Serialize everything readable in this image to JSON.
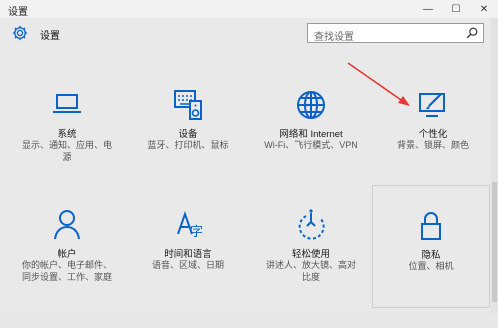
{
  "window": {
    "title": "设置",
    "controls": {
      "minimize": "—",
      "maximize": "☐",
      "close": "✕"
    }
  },
  "header": {
    "icon": "gear-icon",
    "title": "设置"
  },
  "search": {
    "placeholder": "查找设置",
    "icon": "search-icon"
  },
  "accent_color": "#0a63c9",
  "annotation_arrow_color": "#e53935",
  "tiles": [
    {
      "id": "system",
      "icon": "laptop-icon",
      "name": "系统",
      "desc_lines": [
        "显示、通知、应用、电",
        "源"
      ]
    },
    {
      "id": "devices",
      "icon": "keyboard-speaker-icon",
      "name": "设备",
      "desc_lines": [
        "蓝牙、打印机、鼠标"
      ]
    },
    {
      "id": "network",
      "icon": "globe-icon",
      "name": "网络和 Internet",
      "desc_lines": [
        "Wi-Fi、飞行模式、VPN"
      ]
    },
    {
      "id": "personalization",
      "icon": "paint-brush-icon",
      "name": "个性化",
      "desc_lines": [
        "背景、锁屏、颜色"
      ]
    },
    {
      "id": "accounts",
      "icon": "person-icon",
      "name": "帐户",
      "desc_lines": [
        "你的帐户、电子邮件、",
        "同步设置、工作、家庭"
      ]
    },
    {
      "id": "time-language",
      "icon": "time-language-icon",
      "name": "时间和语言",
      "desc_lines": [
        "语音、区域、日期"
      ]
    },
    {
      "id": "ease-of-access",
      "icon": "ease-of-access-icon",
      "name": "轻松使用",
      "desc_lines": [
        "讲述人、放大镜、高对",
        "比度"
      ]
    },
    {
      "id": "privacy",
      "icon": "lock-icon",
      "name": "隐私",
      "desc_lines": [
        "位置、相机"
      ]
    }
  ]
}
